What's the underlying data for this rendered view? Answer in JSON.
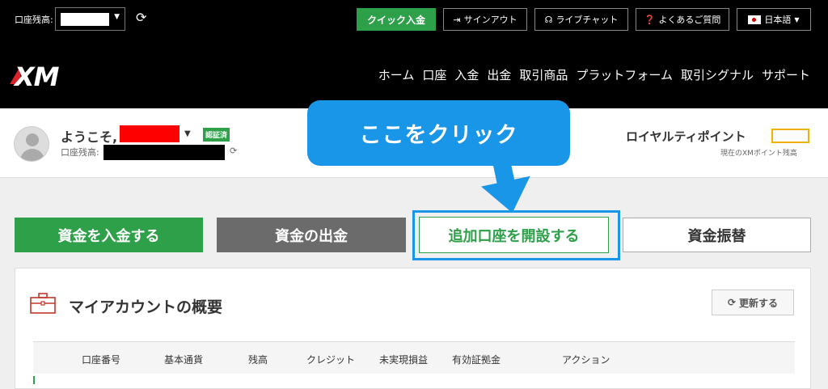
{
  "topbar": {
    "balance_label": "口座残高:",
    "quick_deposit": "クイック入金",
    "signout": "サインアウト",
    "live_chat": "ライブチャット",
    "faq": "よくあるご質問",
    "language": "日本語"
  },
  "nav": {
    "logo": "XM",
    "items": [
      "ホーム",
      "口座",
      "入金",
      "出金",
      "取引商品",
      "プラットフォーム",
      "取引シグナル",
      "サポート"
    ]
  },
  "welcome": {
    "greeting": "ようこそ,",
    "verified_badge": "認証済",
    "balance_label": "口座残高:",
    "royalty_label": "ロイヤルティポイント",
    "royalty_sub": "現在のXMポイント残高"
  },
  "callout": {
    "text": "ここをクリック"
  },
  "actions": {
    "deposit": "資金を入金する",
    "withdraw": "資金の出金",
    "open_account": "追加口座を開設する",
    "transfer": "資金振替"
  },
  "overview": {
    "title": "マイアカウントの概要",
    "refresh": "更新する",
    "columns": [
      "口座番号",
      "基本通貨",
      "残高",
      "クレジット",
      "未実現損益",
      "有効証拠金",
      "アクション"
    ]
  },
  "colors": {
    "accent_green": "#2fa04a",
    "callout_blue": "#1a96e8",
    "brand_red": "#d9232a"
  }
}
